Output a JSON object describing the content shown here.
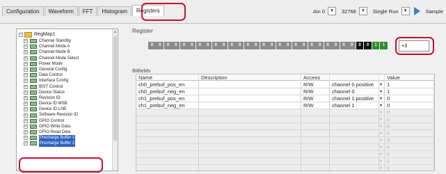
{
  "tabs": [
    "Configuration",
    "Waveform",
    "FFT",
    "Histogram",
    "Registers"
  ],
  "toolbar": {
    "channel": "Ain 0",
    "samples": "32768",
    "run_mode": "Single Run",
    "sample_label": "Sample"
  },
  "tree": {
    "root": "RegMap1",
    "items": [
      "Channel Standby",
      "Channel Mode A",
      "Channel Mode B",
      "Channel Mode Select",
      "Power Mode",
      "General Config",
      "Data Control",
      "Interface Config",
      "BIST Control",
      "Device Status",
      "Revision ID",
      "Device ID MSB",
      "Device ID LSB",
      "Software Revision ID",
      "GPIO Control",
      "GPIO Write Data",
      "GPIO Read Data",
      "Precharge Buffer 1",
      "Precharge Buffer 2"
    ]
  },
  "register": {
    "title": "Register",
    "bits": [
      "0",
      "0",
      "0",
      "0",
      "0",
      "0",
      "0",
      "0",
      "0",
      "0",
      "0",
      "0",
      "0",
      "0",
      "0",
      "0",
      "0",
      "0",
      "0",
      "0",
      "0",
      "0",
      "0",
      "0",
      "0",
      "0",
      "0",
      "0",
      "1",
      "1"
    ],
    "value": "+3"
  },
  "bitfields": {
    "title": "Bitfields",
    "headers": [
      "Name",
      "Description",
      "Access",
      "Value"
    ],
    "rows": [
      {
        "name": "ch0_prebuf_pos_en",
        "description": "",
        "access": "R/W",
        "channel": "channel 0 positive",
        "value": "1"
      },
      {
        "name": "ch0_prebuf_neg_en",
        "description": "",
        "access": "R/W",
        "channel": "channel 0",
        "value": "1"
      },
      {
        "name": "ch1_prebuf_pos_en",
        "description": "",
        "access": "R/W",
        "channel": "channel 1 positive",
        "value": "0"
      },
      {
        "name": "ch1_prebuf_neg_en",
        "description": "",
        "access": "R/W",
        "channel": "channel 1",
        "value": "0"
      }
    ],
    "empty_value": "0"
  },
  "colors": {
    "highlight_ring": "#c8102e",
    "selection": "#2f63c0",
    "bit_set": "#2e8b2e"
  }
}
